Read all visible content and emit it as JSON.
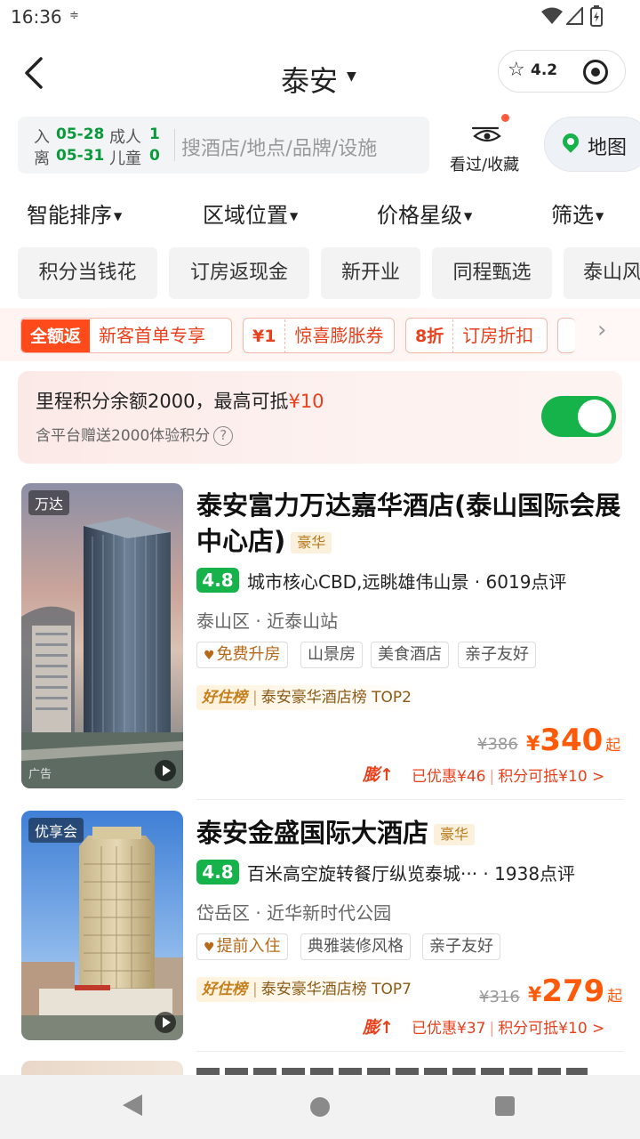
{
  "status_bar": {
    "time": "16:36"
  },
  "header": {
    "city": "泰安",
    "rating": "4.2"
  },
  "search": {
    "checkin_label": "入",
    "checkin_date": "05-28",
    "checkout_label": "离",
    "checkout_date": "05-31",
    "adults_label": "成人",
    "adults": "1",
    "children_label": "儿童",
    "children": "0",
    "placeholder": "搜酒店/地点/品牌/设施",
    "viewed_label": "看过/收藏",
    "map_label": "地图"
  },
  "sort_tabs": [
    "智能排序",
    "区域位置",
    "价格星级",
    "筛选"
  ],
  "chips": [
    "积分当钱花",
    "订房返现金",
    "新开业",
    "同程甄选",
    "泰山风"
  ],
  "promos": [
    {
      "tag": "全额返",
      "text": "新客首单专享"
    },
    {
      "tag": "¥1",
      "text": "惊喜膨胀券"
    },
    {
      "tag": "8折",
      "text": "订房折扣"
    }
  ],
  "mileage": {
    "line1_prefix": "里程积分余额2000，最高可抵",
    "line1_amount": "¥10",
    "line2": "含平台赠送2000体验积分",
    "help": "?",
    "enabled": true
  },
  "hotels": [
    {
      "badge": "万达",
      "ad": "广告",
      "name": "泰安富力万达嘉华酒店(泰山国际会展中心店)",
      "tier": "豪华",
      "score": "4.8",
      "desc": "城市核心CBD,远眺雄伟山景 · 6019点评",
      "location": "泰山区 · 近泰山站",
      "tags": [
        "免费升房",
        "山景房",
        "美食酒店",
        "亲子友好"
      ],
      "rank_logo": "好住榜",
      "rank_text": "泰安豪华酒店榜 TOP2",
      "old_price": "¥386",
      "price_symbol": "¥",
      "price": "340",
      "price_suffix": "起",
      "boost": "膨↑",
      "discount": "已优惠¥46",
      "points": "积分可抵¥10 >"
    },
    {
      "badge": "优享会",
      "name": "泰安金盛国际大酒店",
      "tier": "豪华",
      "score": "4.8",
      "desc": "百米高空旋转餐厅纵览泰城··· · 1938点评",
      "location": "岱岳区 · 近华新时代公园",
      "tags": [
        "提前入住",
        "典雅装修风格",
        "亲子友好"
      ],
      "rank_logo": "好住榜",
      "rank_text": "泰安豪华酒店榜 TOP7",
      "old_price": "¥316",
      "price_symbol": "¥",
      "price": "279",
      "price_suffix": "起",
      "boost": "膨↑",
      "discount": "已优惠¥37",
      "points": "积分可抵¥10 >"
    }
  ],
  "colors": {
    "accent": "#16b24a",
    "price": "#ff5a0a",
    "promo": "#e8401c"
  }
}
